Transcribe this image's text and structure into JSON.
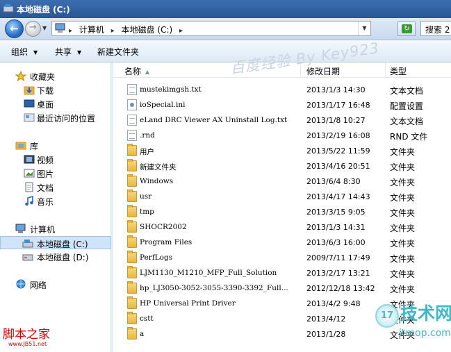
{
  "window": {
    "title": "本地磁盘 (C:)"
  },
  "address": {
    "crumbs": [
      "计算机",
      "本地磁盘 (C:)"
    ],
    "search_placeholder": "搜索 2"
  },
  "toolbar": {
    "organize": "组织",
    "share": "共享",
    "new_folder": "新建文件夹"
  },
  "nav": {
    "favorites": "收藏夹",
    "downloads": "下载",
    "desktop": "桌面",
    "recent": "最近访问的位置",
    "libraries": "库",
    "videos": "视频",
    "pictures": "图片",
    "documents": "文档",
    "music": "音乐",
    "computer": "计算机",
    "drive_c": "本地磁盘 (C:)",
    "drive_d": "本地磁盘 (D:)",
    "network": "网络"
  },
  "columns": {
    "name": "名称",
    "modified": "修改日期",
    "type": "类型"
  },
  "files": [
    {
      "name": "mustekimgsh.txt",
      "date": "2013/1/3 14:30",
      "type": "文本文档",
      "icon": "doc"
    },
    {
      "name": "ioSpecial.ini",
      "date": "2013/1/17 16:48",
      "type": "配置设置",
      "icon": "ini"
    },
    {
      "name": "eLand DRC Viewer AX Uninstall Log.txt",
      "date": "2013/1/8 10:27",
      "type": "文本文档",
      "icon": "doc"
    },
    {
      "name": ".rnd",
      "date": "2013/2/19 16:08",
      "type": "RND 文件",
      "icon": "doc"
    },
    {
      "name": "用户",
      "date": "2013/5/22 11:59",
      "type": "文件夹",
      "icon": "folder"
    },
    {
      "name": "新建文件夹",
      "date": "2013/4/16 20:51",
      "type": "文件夹",
      "icon": "folder"
    },
    {
      "name": "Windows",
      "date": "2013/6/4 8:30",
      "type": "文件夹",
      "icon": "folder"
    },
    {
      "name": "usr",
      "date": "2013/4/17 14:43",
      "type": "文件夹",
      "icon": "folder"
    },
    {
      "name": "tmp",
      "date": "2013/3/15 9:05",
      "type": "文件夹",
      "icon": "folder"
    },
    {
      "name": "SHOCR2002",
      "date": "2013/1/3 14:31",
      "type": "文件夹",
      "icon": "folder"
    },
    {
      "name": "Program Files",
      "date": "2013/6/3 16:00",
      "type": "文件夹",
      "icon": "folder"
    },
    {
      "name": "PerfLogs",
      "date": "2009/7/11 17:49",
      "type": "文件夹",
      "icon": "folder"
    },
    {
      "name": "LJM1130_M1210_MFP_Full_Solution",
      "date": "2013/2/17 13:21",
      "type": "文件夹",
      "icon": "folder"
    },
    {
      "name": "hp_LJ3050-3052-3055-3390-3392_Full...",
      "date": "2012/12/18 13:42",
      "type": "文件夹",
      "icon": "folder"
    },
    {
      "name": "HP Universal Print Driver",
      "date": "2013/4/2 9:48",
      "type": "文件夹",
      "icon": "folder"
    },
    {
      "name": "cstt",
      "date": "2013/4/12 ",
      "type": "文件夹",
      "icon": "folder"
    },
    {
      "name": "a",
      "date": "2013/1/28 ",
      "type": "文件夹",
      "icon": "folder"
    }
  ],
  "watermarks": {
    "baidu": "百度经验 By Key923",
    "jb51_cn": "脚本之家",
    "jb51_url": "www.JB51.net",
    "tech_big": "技术网",
    "tech_small": "itmop.com",
    "tech_circle": "17"
  },
  "colors": {
    "titlebar": "#2a5694",
    "selection": "#cfe4f8",
    "folder": "#e8b640"
  }
}
